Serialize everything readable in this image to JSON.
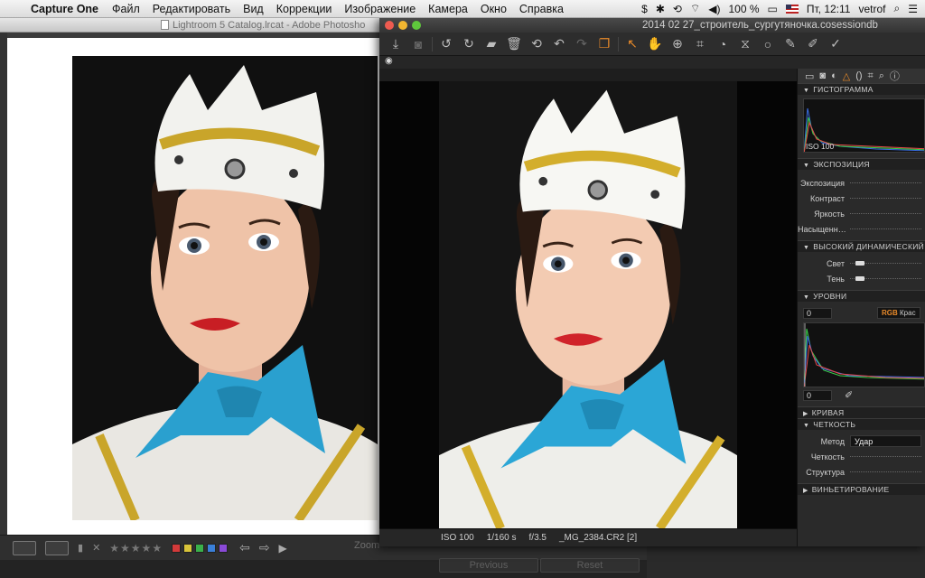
{
  "menubar": {
    "app_name": "Capture One",
    "menus": [
      "Файл",
      "Редактировать",
      "Вид",
      "Коррекции",
      "Изображение",
      "Камера",
      "Окно",
      "Справка"
    ],
    "battery": "100 %",
    "clock": "Пт, 12:11",
    "user": "vetrof"
  },
  "lightroom": {
    "title": "Lightroom 5 Catalog.lrcat - Adobe Photosho",
    "stars": "★★★★★",
    "zoom_label": "Zoom",
    "previous_label": "Previous",
    "reset_label": "Reset",
    "label_colors": [
      "#d33a3a",
      "#d8c43a",
      "#3ab04a",
      "#3a7fd8",
      "#8a4ad8"
    ]
  },
  "captureone": {
    "title": "2014 02 27_строитель_сургутяночка.cosessiondb",
    "status": {
      "iso": "ISO 100",
      "shutter": "1/160 s",
      "aperture": "f/3.5",
      "filename": "_MG_2384.CR2 [2]"
    },
    "tools": {
      "histogram": {
        "title": "ГИСТОГРАММА",
        "iso": "ISO 100"
      },
      "exposure": {
        "title": "ЭКСПОЗИЦИЯ",
        "rows": [
          "Экспозиция",
          "Контраст",
          "Яркость",
          "Насыщенн…"
        ]
      },
      "hdr": {
        "title": "ВЫСОКИЙ ДИНАМИЧЕСКИЙ",
        "rows": [
          "Свет",
          "Тень"
        ]
      },
      "levels": {
        "title": "УРОВНИ",
        "low": "0",
        "high": "0",
        "channel_rgb": "RGB",
        "channel_red": "Крас"
      },
      "curve": {
        "title": "КРИВАЯ"
      },
      "clarity": {
        "title": "ЧЕТКОСТЬ",
        "method_label": "Метод",
        "method_value": "Удар",
        "rows": [
          "Четкость",
          "Структура"
        ]
      },
      "vignette": {
        "title": "ВИНЬЕТИРОВАНИЕ"
      }
    }
  }
}
